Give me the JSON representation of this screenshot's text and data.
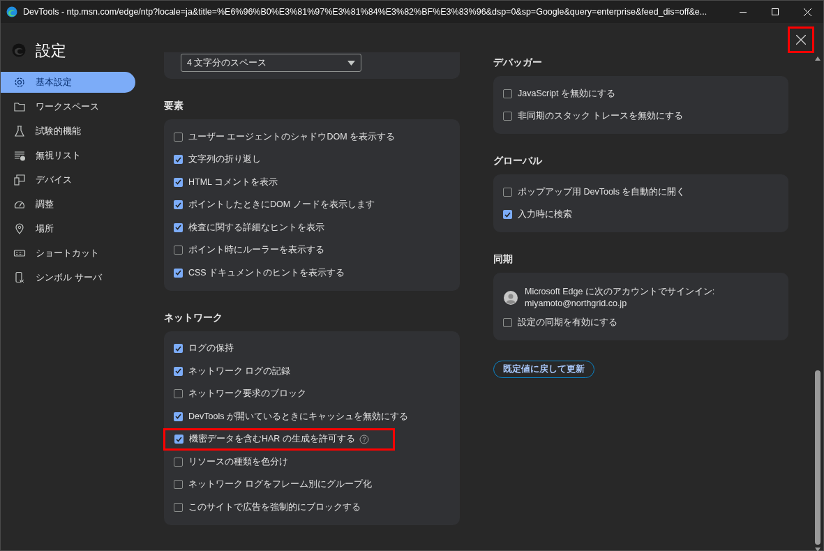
{
  "window": {
    "title": "DevTools - ntp.msn.com/edge/ntp?locale=ja&title=%E6%96%B0%E3%81%97%E3%81%84%E3%82%BF%E3%83%96&dsp=0&sp=Google&query=enterprise&feed_dis=off&e..."
  },
  "sidebar": {
    "title": "設定",
    "items": [
      {
        "label": "基本設定",
        "selected": true
      },
      {
        "label": "ワークスペース",
        "selected": false
      },
      {
        "label": "試験的機能",
        "selected": false
      },
      {
        "label": "無視リスト",
        "selected": false
      },
      {
        "label": "デバイス",
        "selected": false
      },
      {
        "label": "調整",
        "selected": false
      },
      {
        "label": "場所",
        "selected": false
      },
      {
        "label": "ショートカット",
        "selected": false
      },
      {
        "label": "シンボル サーバ",
        "selected": false
      }
    ]
  },
  "settings_close": {
    "highlighted": true
  },
  "left_column": [
    {
      "rows": [
        {
          "kind": "dropdown",
          "value": "4 文字分のスペース"
        }
      ]
    },
    {
      "heading": "要素",
      "rows": [
        {
          "kind": "checkbox",
          "label": "ユーザー エージェントのシャドウDOM を表示する",
          "checked": false
        },
        {
          "kind": "checkbox",
          "label": "文字列の折り返し",
          "checked": true
        },
        {
          "kind": "checkbox",
          "label": "HTML コメントを表示",
          "checked": true
        },
        {
          "kind": "checkbox",
          "label": "ポイントしたときにDOM ノードを表示します",
          "checked": true
        },
        {
          "kind": "checkbox",
          "label": "検査に関する詳細なヒントを表示",
          "checked": true
        },
        {
          "kind": "checkbox",
          "label": "ポイント時にルーラーを表示する",
          "checked": false
        },
        {
          "kind": "checkbox",
          "label": "CSS ドキュメントのヒントを表示する",
          "checked": true
        }
      ]
    },
    {
      "heading": "ネットワーク",
      "rows": [
        {
          "kind": "checkbox",
          "label": "ログの保持",
          "checked": true,
          "highlighted": false,
          "help": false
        },
        {
          "kind": "checkbox",
          "label": "ネットワーク ログの記録",
          "checked": true,
          "highlighted": false,
          "help": false
        },
        {
          "kind": "checkbox",
          "label": "ネットワーク要求のブロック",
          "checked": false,
          "highlighted": false,
          "help": false
        },
        {
          "kind": "checkbox",
          "label": "DevTools が開いているときにキャッシュを無効にする",
          "checked": true,
          "highlighted": false,
          "help": false
        },
        {
          "kind": "checkbox",
          "label": "機密データを含むHAR の生成を許可する",
          "checked": true,
          "highlighted": true,
          "help": true
        },
        {
          "kind": "checkbox",
          "label": "リソースの種類を色分け",
          "checked": false,
          "highlighted": false,
          "help": false
        },
        {
          "kind": "checkbox",
          "label": "ネットワーク ログをフレーム別にグループ化",
          "checked": false,
          "highlighted": false,
          "help": false
        },
        {
          "kind": "checkbox",
          "label": "このサイトで広告を強制的にブロックする",
          "checked": false,
          "highlighted": false,
          "help": false
        }
      ]
    }
  ],
  "right_column": [
    {
      "heading": "デバッガー",
      "rows": [
        {
          "kind": "checkbox",
          "label": "JavaScript を無効にする",
          "checked": false
        },
        {
          "kind": "checkbox",
          "label": "非同期のスタック トレースを無効にする",
          "checked": false
        }
      ]
    },
    {
      "heading": "グローバル",
      "rows": [
        {
          "kind": "checkbox",
          "label": "ポップアップ用 DevTools を自動的に開く",
          "checked": false
        },
        {
          "kind": "checkbox",
          "label": "入力時に検索",
          "checked": true
        }
      ]
    },
    {
      "heading": "同期",
      "rows": [
        {
          "kind": "account",
          "text": "Microsoft Edge に次のアカウントでサインイン:",
          "email": "miyamoto@northgrid.co.jp"
        },
        {
          "kind": "checkbox",
          "label": "設定の同期を有効にする",
          "checked": false
        }
      ]
    }
  ],
  "reset_button": "既定値に戻して更新"
}
